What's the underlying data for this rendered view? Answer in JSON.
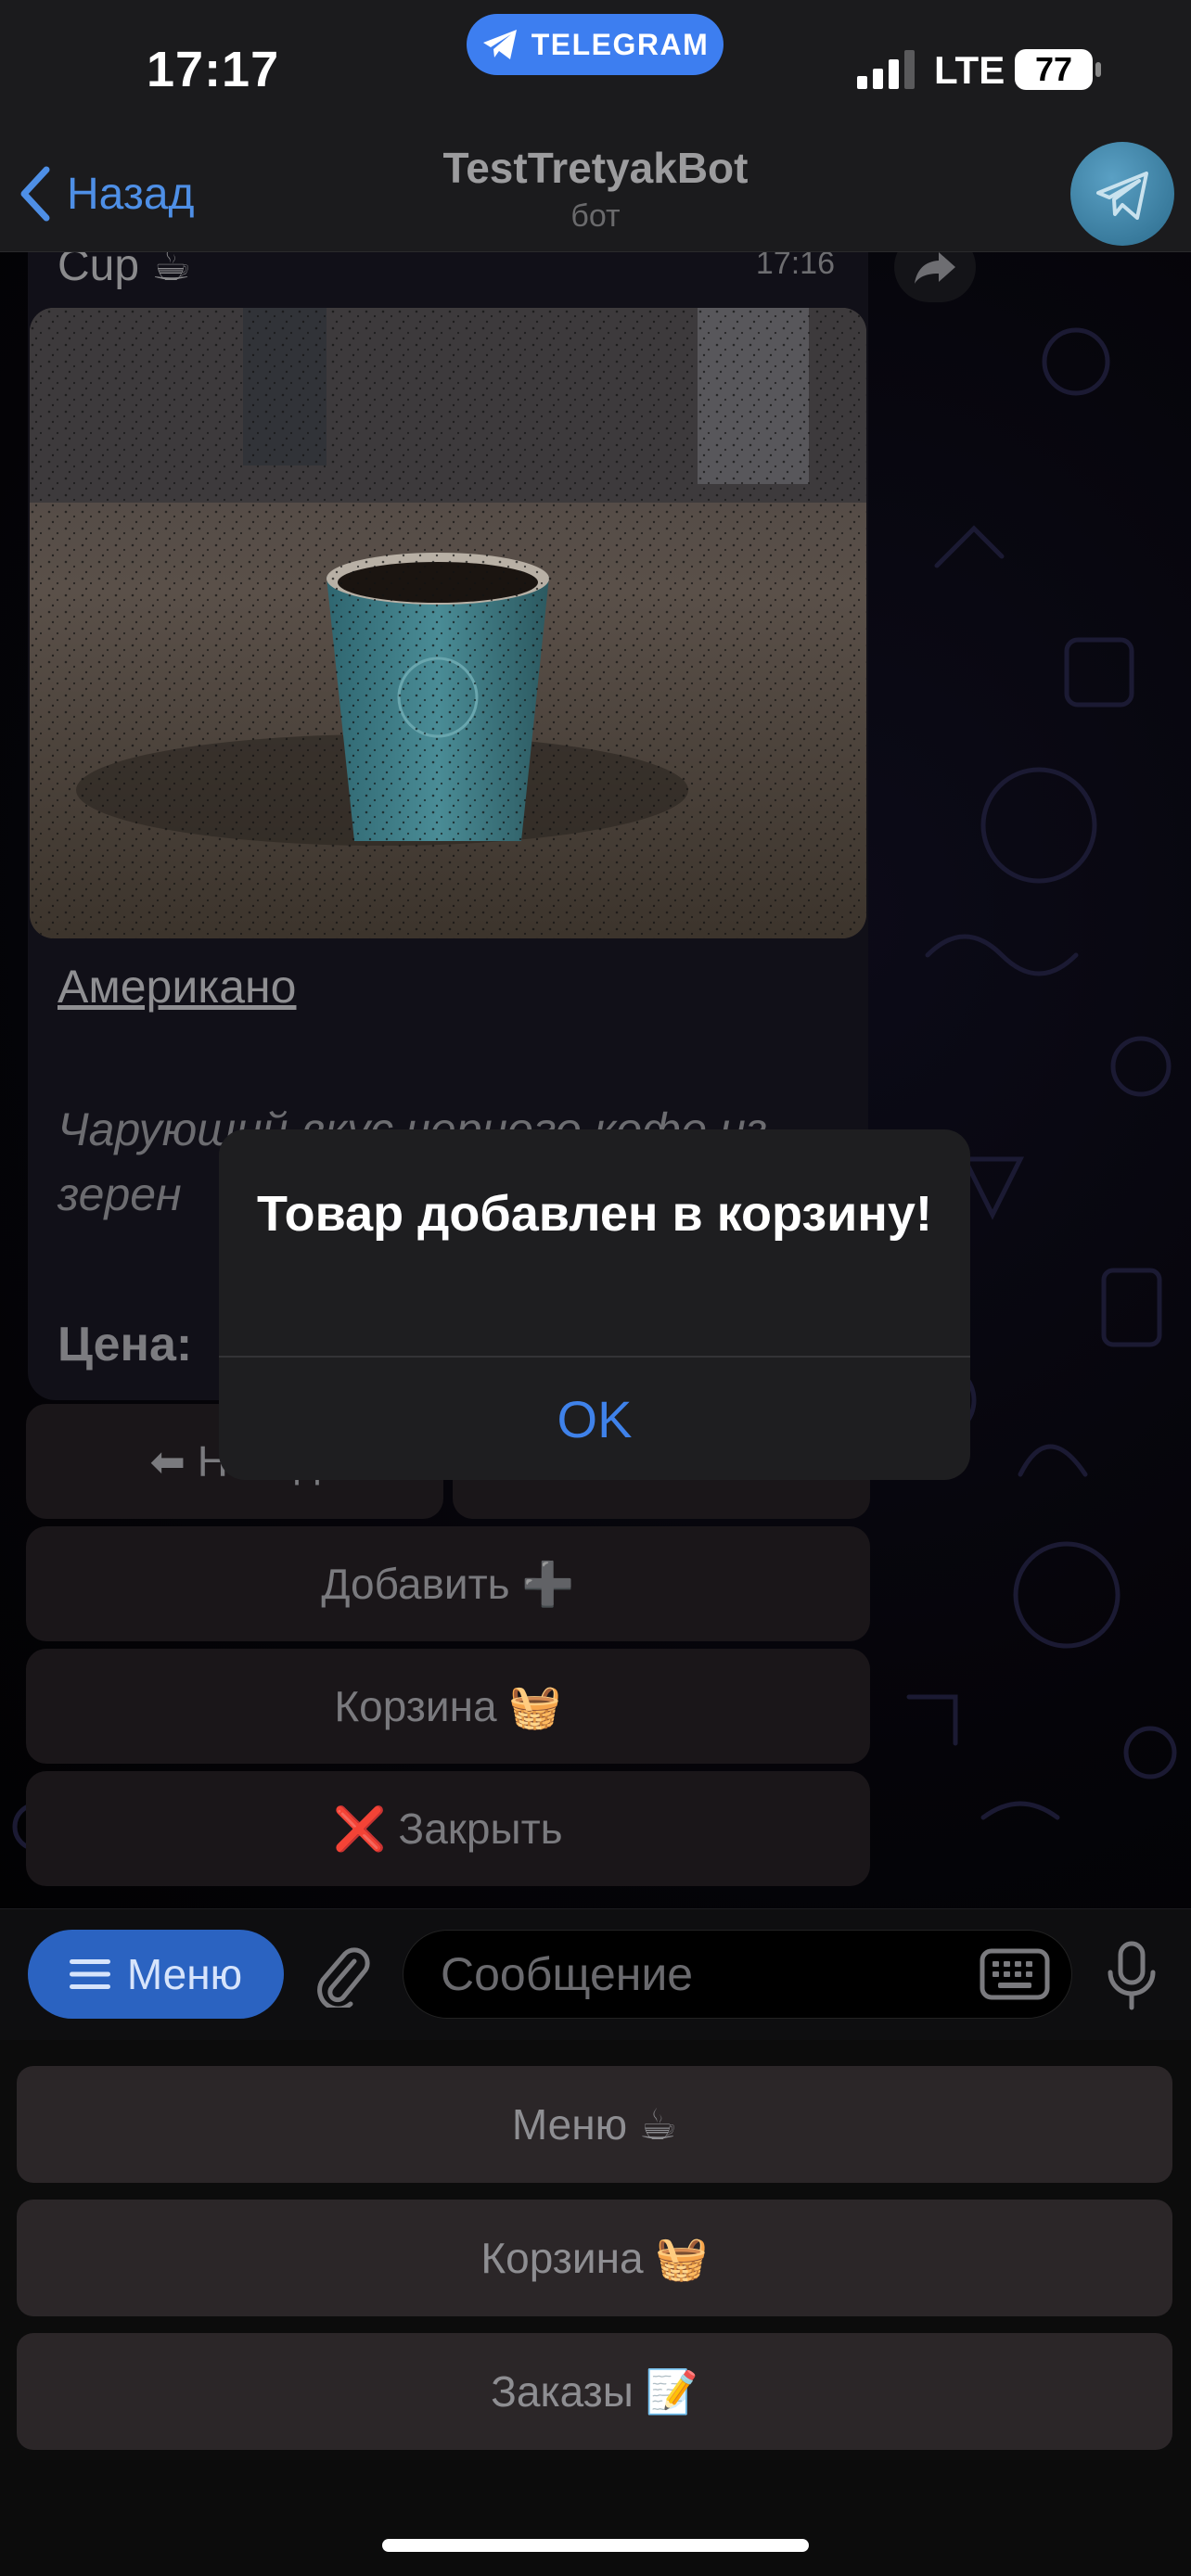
{
  "status_bar": {
    "time": "17:17",
    "app_pill": "TELEGRAM",
    "network": "LTE",
    "battery": "77"
  },
  "nav": {
    "back_label": "Назад",
    "title": "TestTretyakBot",
    "subtitle": "бот"
  },
  "message": {
    "caption_top": "Cup ☕",
    "time": "17:16",
    "item_name": "Американо",
    "item_description": "Чарующий вкус черного кофе из зерен",
    "price_label": "Цена:"
  },
  "inline_keyboard": {
    "nav_left": "⬅ Назад",
    "nav_right": "",
    "add": "Добавить ➕",
    "cart": "Корзина 🧺",
    "close": "❌ Закрыть"
  },
  "input_bar": {
    "menu_label": "Меню",
    "placeholder": "Сообщение"
  },
  "reply_keyboard": {
    "menu": "Меню ☕",
    "cart": "Корзина 🧺",
    "orders": "Заказы 📝"
  },
  "alert": {
    "title": "Товар добавлен в корзину!",
    "ok": "OK"
  },
  "colors": {
    "accent": "#3f82ea",
    "telegram_pill": "#3d7ef0",
    "menu_button": "#2b63c1"
  }
}
